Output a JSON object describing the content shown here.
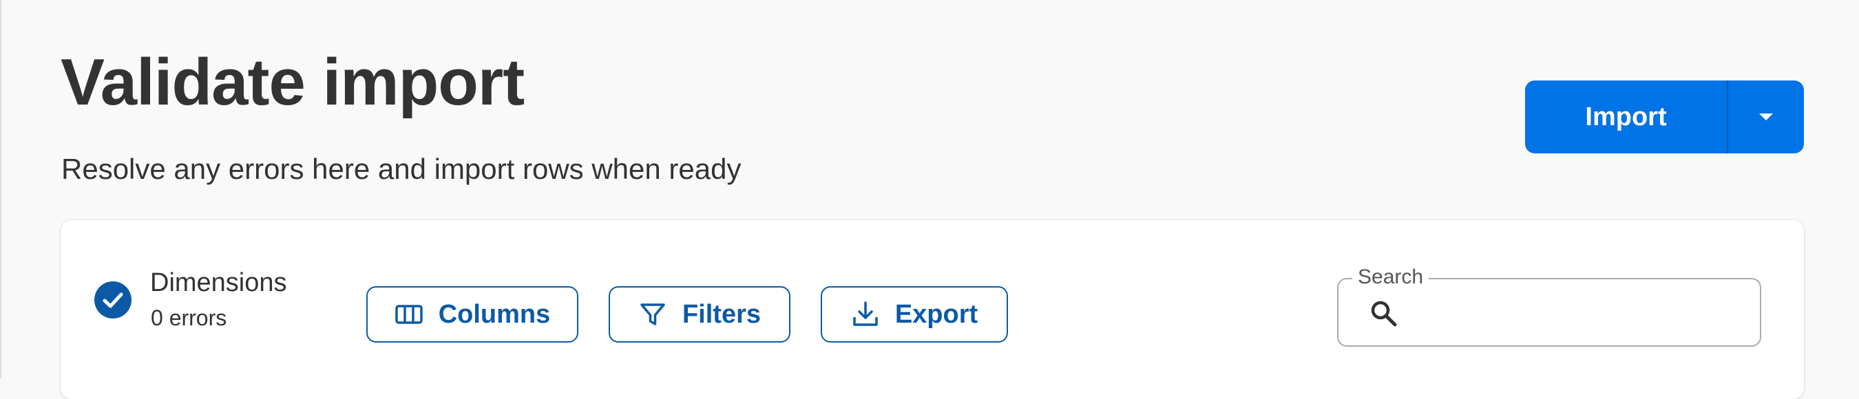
{
  "header": {
    "title": "Validate import",
    "subtitle": "Resolve any errors here and import rows when ready"
  },
  "import_button": {
    "label": "Import",
    "icon": "caret-down-icon"
  },
  "status": {
    "title": "Dimensions",
    "errors_label": "0 errors",
    "icon": "check-circle-icon"
  },
  "toolbar": {
    "columns_label": "Columns",
    "filters_label": "Filters",
    "export_label": "Export"
  },
  "search": {
    "label": "Search",
    "value": "",
    "placeholder": ""
  },
  "colors": {
    "primary": "#0073e6",
    "outline_blue": "#0c5aa6",
    "text": "#333333",
    "background": "#f9f9fa"
  }
}
